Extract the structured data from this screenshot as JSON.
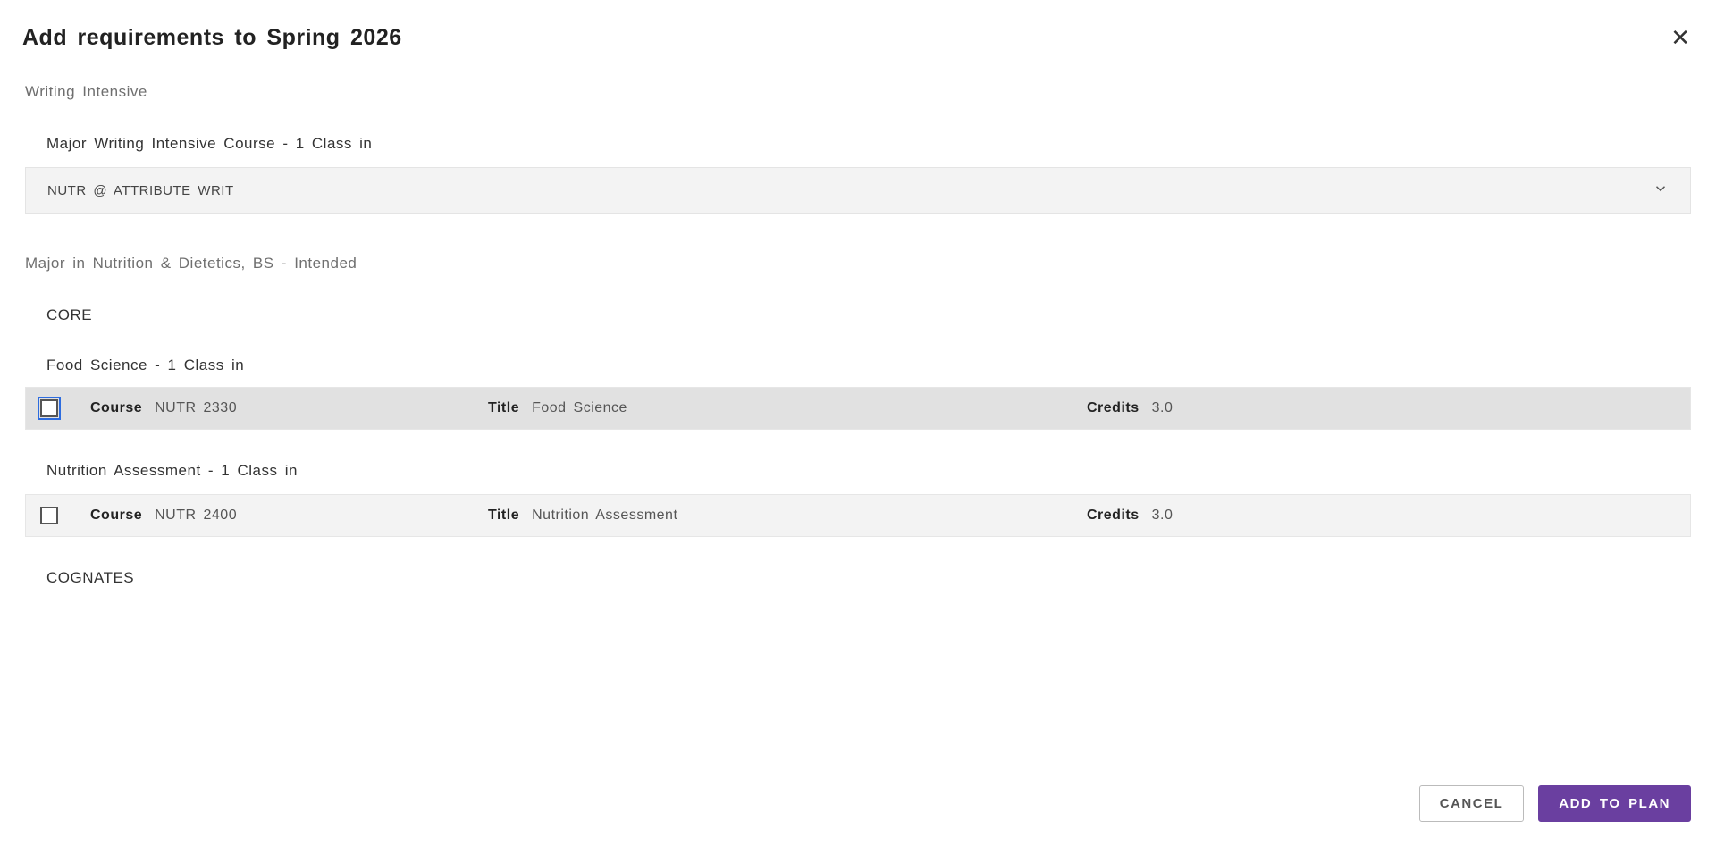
{
  "dialog": {
    "title": "Add requirements to Spring 2026",
    "close_glyph": "✕"
  },
  "sections": {
    "writing_intensive": {
      "label": "Writing Intensive",
      "sub": "Major Writing Intensive Course - 1 Class in",
      "collapsed_label": "NUTR @ ATTRIBUTE WRIT"
    },
    "major": {
      "label": "Major in Nutrition & Dietetics, BS - Intended",
      "core_label": "CORE",
      "food_science": {
        "heading": "Food Science - 1 Class in",
        "labels": {
          "course": "Course",
          "title": "Title",
          "credits": "Credits"
        },
        "course": "NUTR 2330",
        "title": "Food Science",
        "credits": "3.0"
      },
      "nutrition_assessment": {
        "heading": "Nutrition Assessment - 1 Class in",
        "labels": {
          "course": "Course",
          "title": "Title",
          "credits": "Credits"
        },
        "course": "NUTR 2400",
        "title": "Nutrition Assessment",
        "credits": "3.0"
      },
      "cognates_label": "COGNATES"
    }
  },
  "footer": {
    "cancel": "CANCEL",
    "add": "ADD TO PLAN"
  }
}
